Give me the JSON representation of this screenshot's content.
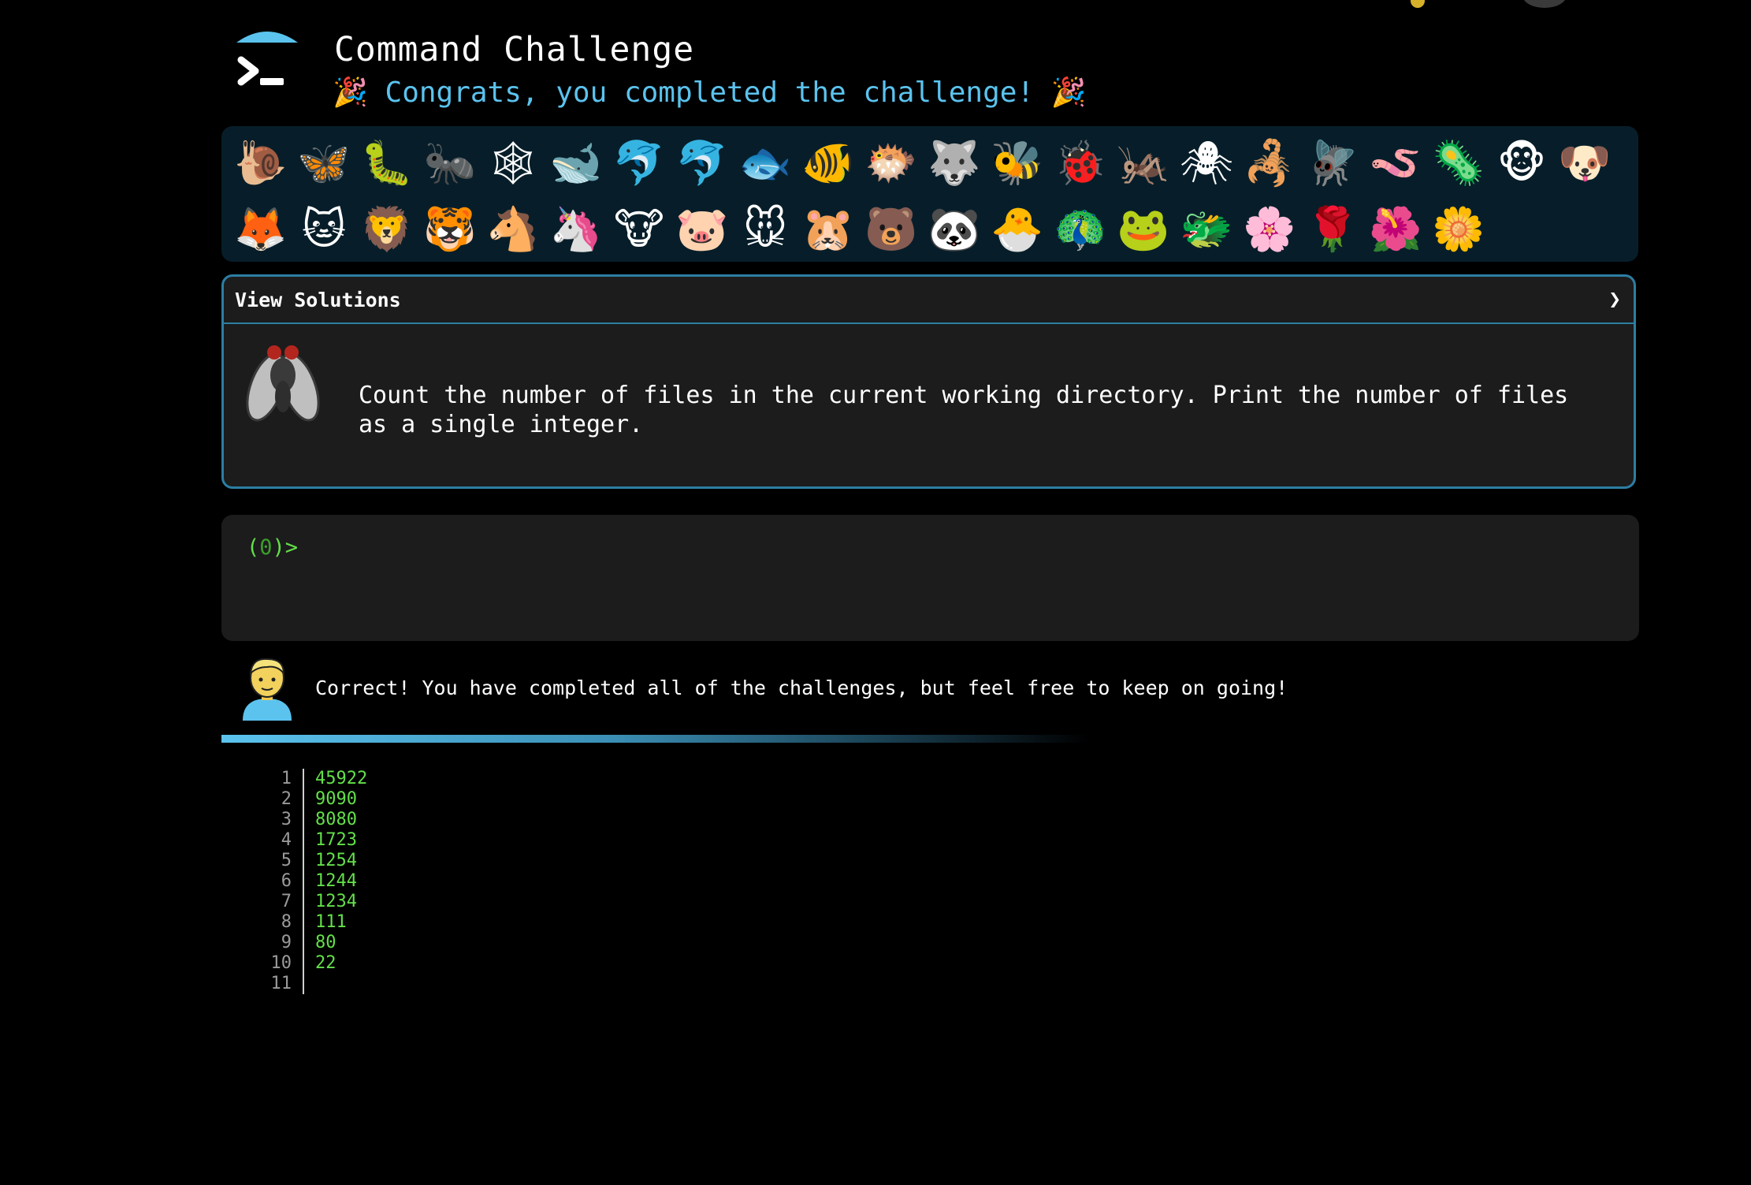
{
  "header": {
    "title": "Command Challenge",
    "congrats_text": "Congrats, you completed the challenge!",
    "party_emoji": "🎉"
  },
  "badges": {
    "row1": [
      "🐌",
      "🦋",
      "🐛",
      "🐜",
      "🕸",
      "🐋",
      "🐬",
      "🐬",
      "🐟",
      "🐠",
      "🐡",
      "🐺",
      "🐝",
      "🐞",
      "🦗",
      "🕷",
      "🦂",
      "🪰",
      "🪱",
      "🦠",
      "🐵",
      "🐶"
    ],
    "row2": [
      "🦊",
      "🐱",
      "🦁",
      "🐯",
      "🐴",
      "🦄",
      "🐮",
      "🐷",
      "🐭",
      "🐹",
      "🐻",
      "🐼",
      "🐣",
      "🦚",
      "🐸",
      "🐲",
      "🌸",
      "🌹",
      "🌺",
      "🌼"
    ]
  },
  "challenge": {
    "view_solutions": "View Solutions",
    "chevron": "❯",
    "icon": "fly-icon",
    "description": "Count the number of files in the current working directory. Print the number of files as a single integer."
  },
  "terminal": {
    "prompt_open": "(",
    "prompt_number": "0",
    "prompt_close": ")>"
  },
  "feedback": {
    "message": "Correct! You have completed all of the challenges, but feel free to keep on going!",
    "progress_percent": 100
  },
  "output": {
    "lines": [
      {
        "n": "1",
        "v": "45922"
      },
      {
        "n": "2",
        "v": "9090"
      },
      {
        "n": "3",
        "v": "8080"
      },
      {
        "n": "4",
        "v": "1723"
      },
      {
        "n": "5",
        "v": "1254"
      },
      {
        "n": "6",
        "v": "1244"
      },
      {
        "n": "7",
        "v": "1234"
      },
      {
        "n": "8",
        "v": "111"
      },
      {
        "n": "9",
        "v": "80"
      },
      {
        "n": "10",
        "v": "22"
      },
      {
        "n": "11",
        "v": ""
      }
    ]
  },
  "colors": {
    "accent": "#5bc3ee",
    "prompt_green": "#63e049",
    "panel_border": "#2c7ea3",
    "badge_bg": "#071e2a"
  }
}
